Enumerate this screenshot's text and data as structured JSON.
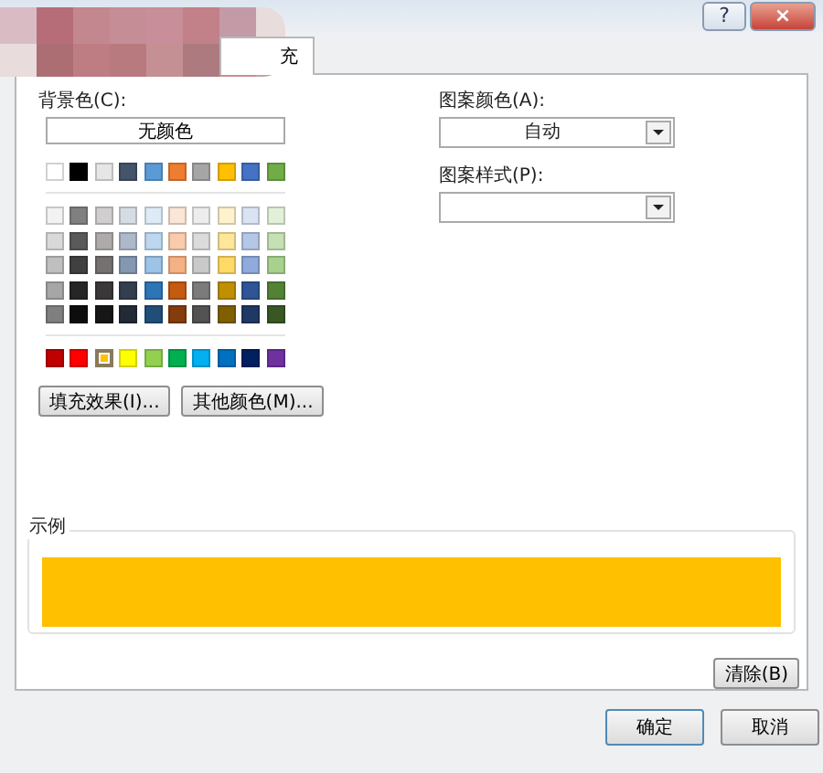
{
  "window": {
    "help_button": "?",
    "close_button": "×"
  },
  "tabs": [
    {
      "label": "充",
      "selected": true
    }
  ],
  "background_color": {
    "label": "背景色(C):",
    "no_color_button": "无颜色",
    "theme_row": [
      {
        "color": "#ffffff",
        "selected": false
      },
      {
        "color": "#000000",
        "selected": false
      },
      {
        "color": "#e7e6e6",
        "selected": false
      },
      {
        "color": "#44546a",
        "selected": false
      },
      {
        "color": "#5b9bd5",
        "selected": false
      },
      {
        "color": "#ed7d31",
        "selected": false
      },
      {
        "color": "#a5a5a5",
        "selected": false
      },
      {
        "color": "#ffc000",
        "selected": false
      },
      {
        "color": "#4472c4",
        "selected": false
      },
      {
        "color": "#70ad47",
        "selected": false
      }
    ],
    "tint_rows": [
      [
        {
          "color": "#f2f2f2",
          "selected": false
        },
        {
          "color": "#808080",
          "selected": false
        },
        {
          "color": "#d0cece",
          "selected": false
        },
        {
          "color": "#d6dce4",
          "selected": false
        },
        {
          "color": "#deebf7",
          "selected": false
        },
        {
          "color": "#fbe5d6",
          "selected": false
        },
        {
          "color": "#ededed",
          "selected": false
        },
        {
          "color": "#fff2cc",
          "selected": false
        },
        {
          "color": "#dae3f3",
          "selected": false
        },
        {
          "color": "#e2f0d9",
          "selected": false
        }
      ],
      [
        {
          "color": "#d9d9d9",
          "selected": false
        },
        {
          "color": "#595959",
          "selected": false
        },
        {
          "color": "#aeaaaa",
          "selected": false
        },
        {
          "color": "#adb9ca",
          "selected": false
        },
        {
          "color": "#bdd7ee",
          "selected": false
        },
        {
          "color": "#f8cbad",
          "selected": false
        },
        {
          "color": "#dbdbdb",
          "selected": false
        },
        {
          "color": "#ffe699",
          "selected": false
        },
        {
          "color": "#b4c7e7",
          "selected": false
        },
        {
          "color": "#c5e0b4",
          "selected": false
        }
      ],
      [
        {
          "color": "#bfbfbf",
          "selected": false
        },
        {
          "color": "#404040",
          "selected": false
        },
        {
          "color": "#757171",
          "selected": false
        },
        {
          "color": "#8497b0",
          "selected": false
        },
        {
          "color": "#9dc3e6",
          "selected": false
        },
        {
          "color": "#f4b183",
          "selected": false
        },
        {
          "color": "#c9c9c9",
          "selected": false
        },
        {
          "color": "#ffd966",
          "selected": false
        },
        {
          "color": "#8faadc",
          "selected": false
        },
        {
          "color": "#a9d18e",
          "selected": false
        }
      ],
      [
        {
          "color": "#a6a6a6",
          "selected": false
        },
        {
          "color": "#262626",
          "selected": false
        },
        {
          "color": "#3a3838",
          "selected": false
        },
        {
          "color": "#333f4f",
          "selected": false
        },
        {
          "color": "#2e75b6",
          "selected": false
        },
        {
          "color": "#c55a11",
          "selected": false
        },
        {
          "color": "#7b7b7b",
          "selected": false
        },
        {
          "color": "#bf9000",
          "selected": false
        },
        {
          "color": "#2f5597",
          "selected": false
        },
        {
          "color": "#548235",
          "selected": false
        }
      ],
      [
        {
          "color": "#7f7f7f",
          "selected": false
        },
        {
          "color": "#0d0d0d",
          "selected": false
        },
        {
          "color": "#171616",
          "selected": false
        },
        {
          "color": "#222a35",
          "selected": false
        },
        {
          "color": "#1f4e79",
          "selected": false
        },
        {
          "color": "#843c0c",
          "selected": false
        },
        {
          "color": "#525252",
          "selected": false
        },
        {
          "color": "#7f6000",
          "selected": false
        },
        {
          "color": "#203864",
          "selected": false
        },
        {
          "color": "#385723",
          "selected": false
        }
      ]
    ],
    "standard_row": [
      {
        "color": "#c00000",
        "selected": false
      },
      {
        "color": "#ff0000",
        "selected": false
      },
      {
        "color": "#ffc000",
        "selected": true
      },
      {
        "color": "#ffff00",
        "selected": false
      },
      {
        "color": "#92d050",
        "selected": false
      },
      {
        "color": "#00b050",
        "selected": false
      },
      {
        "color": "#00b0f0",
        "selected": false
      },
      {
        "color": "#0070c0",
        "selected": false
      },
      {
        "color": "#002060",
        "selected": false
      },
      {
        "color": "#7030a0",
        "selected": false
      }
    ],
    "fill_effects_button": "填充效果(I)...",
    "more_colors_button": "其他颜色(M)..."
  },
  "pattern_color": {
    "label": "图案颜色(A):",
    "value": "自动"
  },
  "pattern_style": {
    "label": "图案样式(P):"
  },
  "sample": {
    "label": "示例"
  },
  "clear_button": "清除(B)",
  "buttons": [
    "确定",
    "取消"
  ]
}
